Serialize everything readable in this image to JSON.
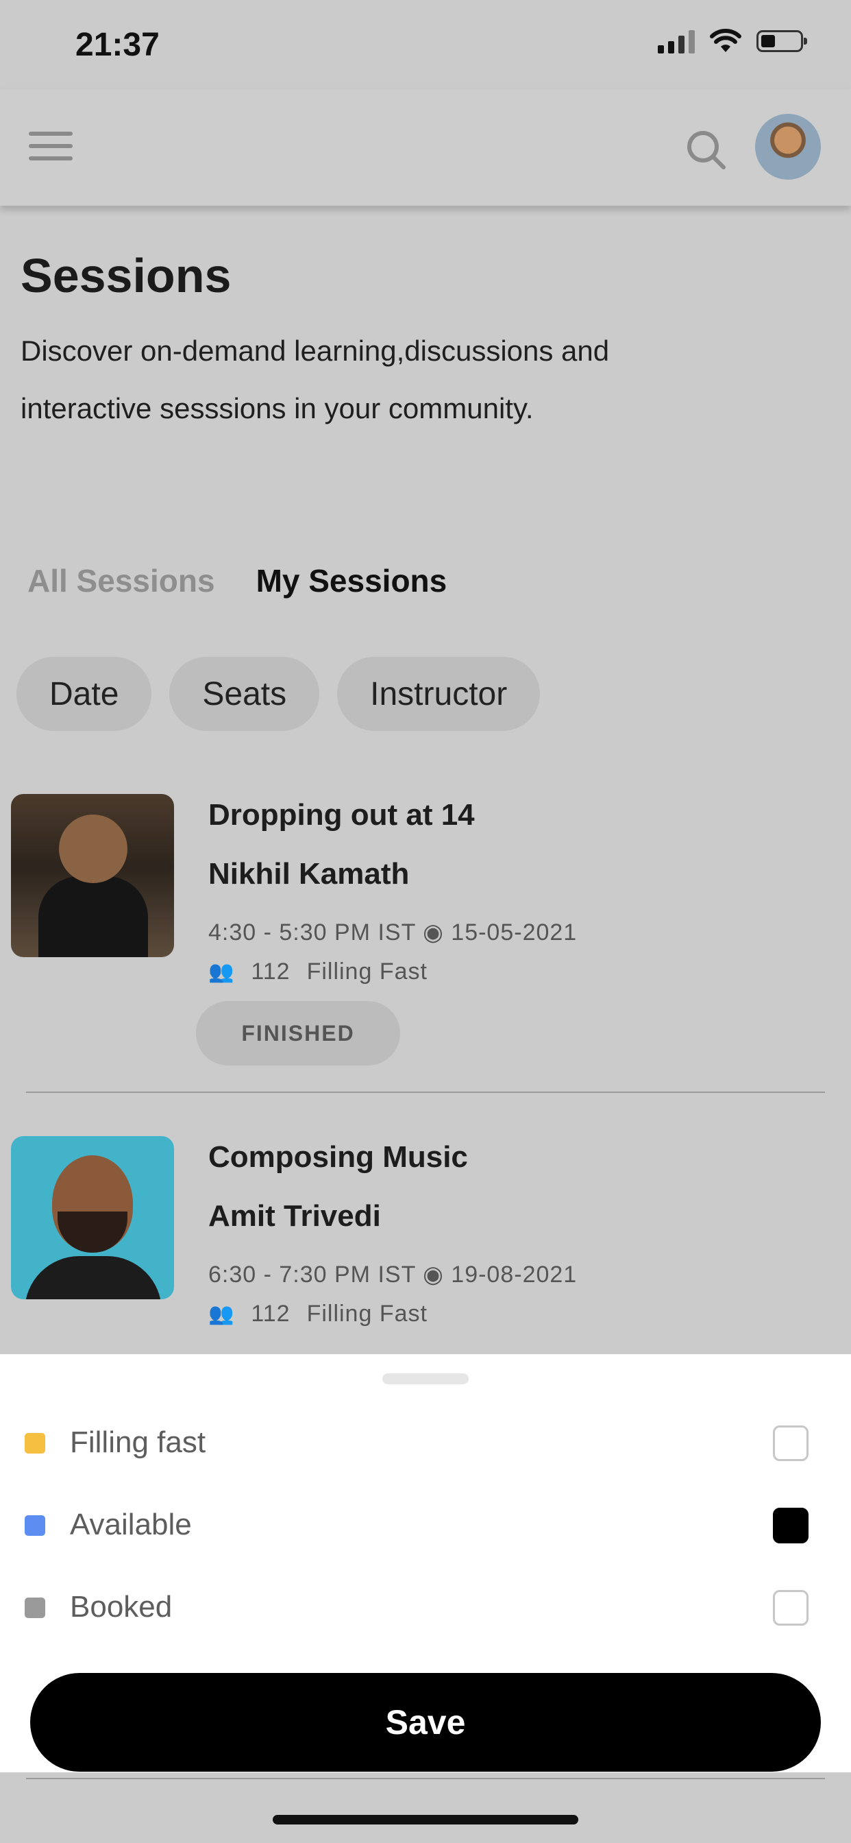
{
  "status_bar": {
    "time": "21:37"
  },
  "header": {
    "menu_icon": "hamburger-menu-icon",
    "search_icon": "search-icon",
    "avatar": "avatar"
  },
  "page": {
    "title": "Sessions",
    "subtitle": "Discover on-demand learning,discussions and interactive sesssions in your community."
  },
  "tabs": [
    {
      "label": "All Sessions",
      "active": false
    },
    {
      "label": "My Sessions",
      "active": true
    }
  ],
  "filters": [
    {
      "label": "Date"
    },
    {
      "label": "Seats"
    },
    {
      "label": "Instructor"
    }
  ],
  "sessions": [
    {
      "title": "Dropping out at 14",
      "instructor": "Nikhil Kamath",
      "time": "4:30 - 5:30 PM IST ◉ 15-05-2021",
      "seats": "112",
      "availability": "Filling Fast",
      "status": "FINISHED"
    },
    {
      "title": "Composing Music",
      "instructor": "Amit Trivedi",
      "time": "6:30 - 7:30 PM IST ◉ 19-08-2021",
      "seats": "112",
      "availability": "Filling Fast"
    }
  ],
  "sheet": {
    "options": [
      {
        "label": "Filling fast",
        "color": "#f5bf42",
        "checked": false
      },
      {
        "label": "Available",
        "color": "#5b8ef0",
        "checked": true
      },
      {
        "label": "Booked",
        "color": "#9a9a9a",
        "checked": false
      }
    ],
    "save_label": "Save"
  }
}
